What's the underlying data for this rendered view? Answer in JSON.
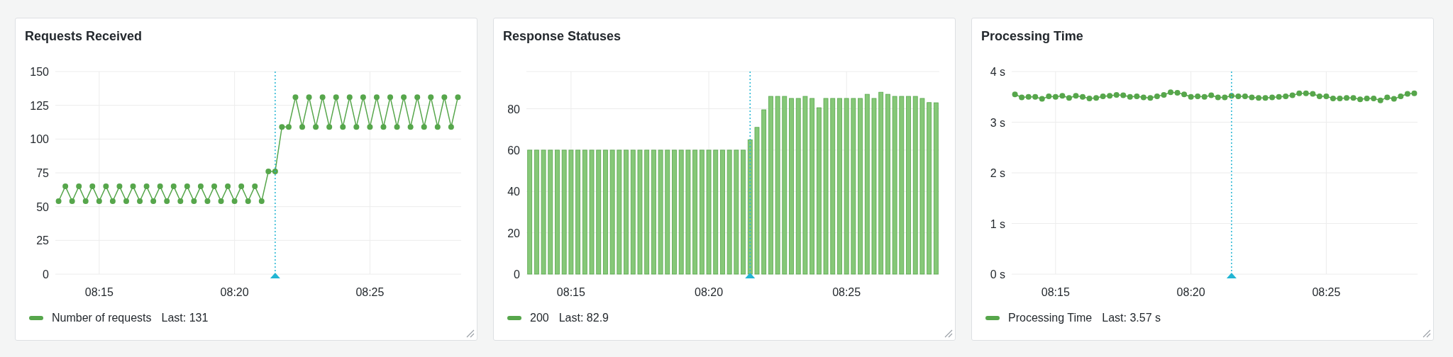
{
  "panels": [
    {
      "title": "Requests Received",
      "legend_last": "Last: 131",
      "chart_data": {
        "type": "line",
        "categories": [
          null,
          null,
          null,
          null,
          null,
          null,
          "08:15",
          null,
          null,
          null,
          null,
          null,
          null,
          null,
          null,
          null,
          null,
          null,
          null,
          null,
          null,
          null,
          null,
          null,
          null,
          null,
          "08:20",
          null,
          null,
          null,
          null,
          null,
          null,
          null,
          null,
          null,
          null,
          null,
          null,
          null,
          null,
          null,
          null,
          null,
          null,
          null,
          "08:25",
          null,
          null,
          null,
          null,
          null,
          null,
          null,
          null,
          null,
          null,
          null,
          null,
          null
        ],
        "series": [
          {
            "name": "Number of requests",
            "color": "#56a64b",
            "marker": true,
            "values": [
              54,
              65,
              54,
              65,
              54,
              65,
              54,
              65,
              54,
              65,
              54,
              65,
              54,
              65,
              54,
              65,
              54,
              65,
              54,
              65,
              54,
              65,
              54,
              65,
              54,
              65,
              54,
              65,
              54,
              65,
              54,
              76,
              76,
              109,
              109,
              131,
              109,
              131,
              109,
              131,
              109,
              131,
              109,
              131,
              109,
              131,
              109,
              131,
              109,
              131,
              109,
              131,
              109,
              131,
              109,
              131,
              109,
              131,
              109,
              131
            ]
          }
        ],
        "ylim": [
          0,
          150
        ],
        "yticks": [
          0,
          25,
          50,
          75,
          100,
          125,
          150
        ],
        "grid": true
      }
    },
    {
      "title": "Response Statuses",
      "legend_last": "Last: 82.9",
      "chart_data": {
        "type": "bar",
        "categories": [
          null,
          null,
          null,
          null,
          null,
          null,
          "08:15",
          null,
          null,
          null,
          null,
          null,
          null,
          null,
          null,
          null,
          null,
          null,
          null,
          null,
          null,
          null,
          null,
          null,
          null,
          null,
          "08:20",
          null,
          null,
          null,
          null,
          null,
          null,
          null,
          null,
          null,
          null,
          null,
          null,
          null,
          null,
          null,
          null,
          null,
          null,
          null,
          "08:25",
          null,
          null,
          null,
          null,
          null,
          null,
          null,
          null,
          null,
          null,
          null,
          null,
          null
        ],
        "series": [
          {
            "name": "200",
            "color": "#56a64b",
            "values": [
              60,
              60,
              60,
              60,
              60,
              60,
              60,
              60,
              60,
              60,
              60,
              60,
              60,
              60,
              60,
              60,
              60,
              60,
              60,
              60,
              60,
              60,
              60,
              60,
              60,
              60,
              60,
              60,
              60,
              60,
              60,
              60,
              65,
              71,
              79.5,
              86,
              86,
              86,
              85,
              85,
              86,
              85,
              80.5,
              85,
              85,
              85,
              85,
              85,
              85,
              87,
              85,
              88,
              87,
              86,
              86,
              86,
              86,
              85,
              83,
              82.9
            ]
          }
        ],
        "ylim": [
          0,
          98
        ],
        "yticks": [
          0,
          20,
          40,
          60,
          80
        ],
        "grid": true
      }
    },
    {
      "title": "Processing Time",
      "legend_last": "Last: 3.57 s",
      "chart_data": {
        "type": "line",
        "categories": [
          null,
          null,
          null,
          null,
          null,
          null,
          "08:15",
          null,
          null,
          null,
          null,
          null,
          null,
          null,
          null,
          null,
          null,
          null,
          null,
          null,
          null,
          null,
          null,
          null,
          null,
          null,
          "08:20",
          null,
          null,
          null,
          null,
          null,
          null,
          null,
          null,
          null,
          null,
          null,
          null,
          null,
          null,
          null,
          null,
          null,
          null,
          null,
          "08:25",
          null,
          null,
          null,
          null,
          null,
          null,
          null,
          null,
          null,
          null,
          null,
          null,
          null
        ],
        "series": [
          {
            "name": "Processing Time",
            "color": "#56a64b",
            "marker": true,
            "values": [
              3.55,
              3.49,
              3.5,
              3.5,
              3.46,
              3.51,
              3.5,
              3.52,
              3.48,
              3.52,
              3.5,
              3.47,
              3.48,
              3.51,
              3.52,
              3.54,
              3.53,
              3.5,
              3.51,
              3.49,
              3.48,
              3.51,
              3.54,
              3.59,
              3.58,
              3.55,
              3.5,
              3.51,
              3.5,
              3.53,
              3.49,
              3.49,
              3.52,
              3.51,
              3.51,
              3.49,
              3.48,
              3.48,
              3.49,
              3.5,
              3.51,
              3.53,
              3.57,
              3.57,
              3.56,
              3.51,
              3.51,
              3.47,
              3.47,
              3.48,
              3.48,
              3.45,
              3.47,
              3.47,
              3.43,
              3.49,
              3.46,
              3.51,
              3.56,
              3.57
            ]
          }
        ],
        "ylim": [
          0,
          4
        ],
        "yticks": [
          {
            "value": 0,
            "label": "0 s"
          },
          {
            "value": 1,
            "label": "1 s"
          },
          {
            "value": 2,
            "label": "2 s"
          },
          {
            "value": 3,
            "label": "3 s"
          },
          {
            "value": 4,
            "label": "4 s"
          }
        ],
        "grid": true
      }
    }
  ]
}
